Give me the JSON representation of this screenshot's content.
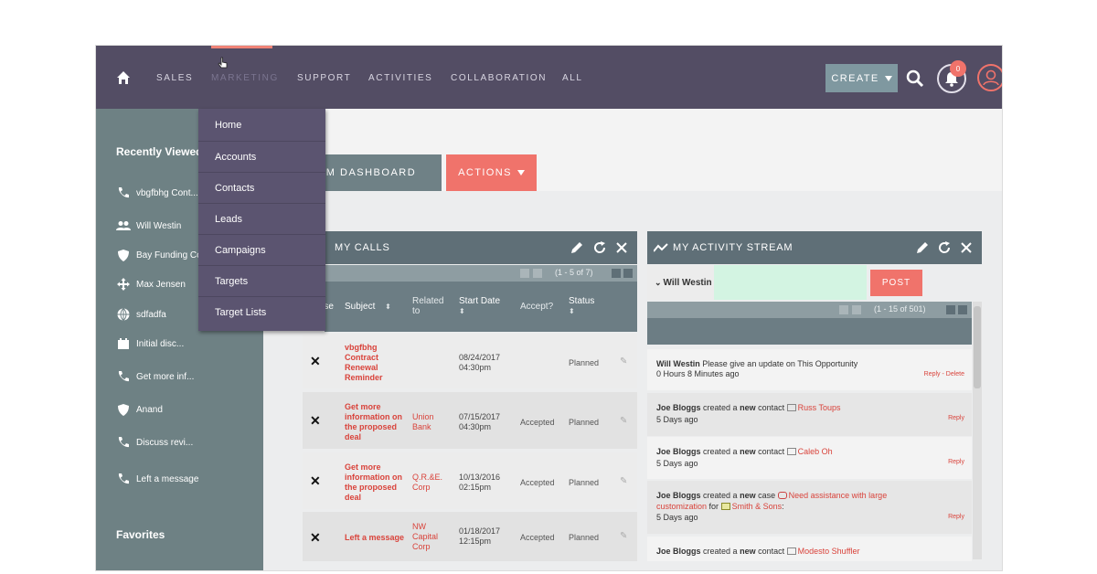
{
  "nav": {
    "items": [
      "SALES",
      "MARKETING",
      "SUPPORT",
      "ACTIVITIES",
      "COLLABORATION",
      "ALL"
    ],
    "create_label": "CREATE",
    "notification_count": "0"
  },
  "dropdown": {
    "items": [
      "Home",
      "Accounts",
      "Contacts",
      "Leads",
      "Campaigns",
      "Targets",
      "Target Lists"
    ]
  },
  "sidebar": {
    "recently_viewed_title": "Recently Viewed",
    "items": [
      {
        "icon": "phone-icon",
        "label": "vbgfbhg Cont..."
      },
      {
        "icon": "people-icon",
        "label": "Will Westin"
      },
      {
        "icon": "shield-icon",
        "label": "Bay Funding Co"
      },
      {
        "icon": "move-icon",
        "label": "Max Jensen"
      },
      {
        "icon": "globe-icon",
        "label": "sdfadfa"
      },
      {
        "icon": "calendar-icon",
        "label": "Initial disc..."
      },
      {
        "icon": "phone-icon",
        "label": "Get more inf..."
      },
      {
        "icon": "shield-icon",
        "label": "Anand"
      },
      {
        "icon": "phone-icon",
        "label": "Discuss revi..."
      },
      {
        "icon": "phone-icon",
        "label": "Left a message"
      }
    ],
    "favorites_title": "Favorites"
  },
  "dashboard": {
    "tab_label": "SUITECRM DASHBOARD",
    "actions_label": "ACTIONS"
  },
  "calls": {
    "title": "MY CALLS",
    "pager": "(1 - 5 of 7)",
    "columns": {
      "close": "Close",
      "subject": "Subject",
      "related": "Related to",
      "start": "Start Date",
      "accept": "Accept?",
      "status": "Status"
    },
    "rows": [
      {
        "subject": "vbgfbhg Contract Renewal Reminder",
        "related": "",
        "date": "08/24/2017",
        "time": "04:30pm",
        "accept": "",
        "status": "Planned"
      },
      {
        "subject": "Get more information on the proposed deal",
        "related": "Union Bank",
        "date": "07/15/2017",
        "time": "04:30pm",
        "accept": "Accepted",
        "status": "Planned"
      },
      {
        "subject": "Get more information on the proposed deal",
        "related": "Q.R.&E. Corp",
        "date": "10/13/2016",
        "time": "02:15pm",
        "accept": "Accepted",
        "status": "Planned"
      },
      {
        "subject": "Left a message",
        "related": "NW Capital Corp",
        "date": "01/18/2017",
        "time": "12:15pm",
        "accept": "Accepted",
        "status": "Planned"
      }
    ]
  },
  "activity": {
    "title": "MY ACTIVITY STREAM",
    "user": "Will Westin",
    "post_label": "POST",
    "pager": "(1 - 15 of 501)",
    "reply_delete": "Reply - Delete",
    "reply": "Reply",
    "entries": [
      {
        "who": "Will Westin",
        "text": "Please give an update on This Opportunity",
        "ago": "0 Hours 8 Minutes ago"
      },
      {
        "who": "Joe Bloggs",
        "pre": "created a",
        "new": "new",
        "kind": "contact",
        "target": "Russ Toups",
        "ago": "5 Days ago"
      },
      {
        "who": "Joe Bloggs",
        "pre": "created a",
        "new": "new",
        "kind": "contact",
        "target": "Caleb Oh",
        "ago": "5 Days ago"
      },
      {
        "who": "Joe Bloggs",
        "pre": "created a",
        "new": "new",
        "kind": "case",
        "target": "Need assistance with large customization",
        "for": "for",
        "account": "Smith & Sons",
        "ago": "5 Days ago"
      },
      {
        "who": "Joe Bloggs",
        "pre": "created a",
        "new": "new",
        "kind": "contact",
        "target": "Modesto Shuffler"
      }
    ]
  },
  "colors": {
    "nav_bg": "#534d64",
    "accent": "#f0736b",
    "sidebar_bg": "#6e8184",
    "dashlet_head": "#5f6f77",
    "link": "#d9433b",
    "post_input": "#d3f4e2"
  }
}
